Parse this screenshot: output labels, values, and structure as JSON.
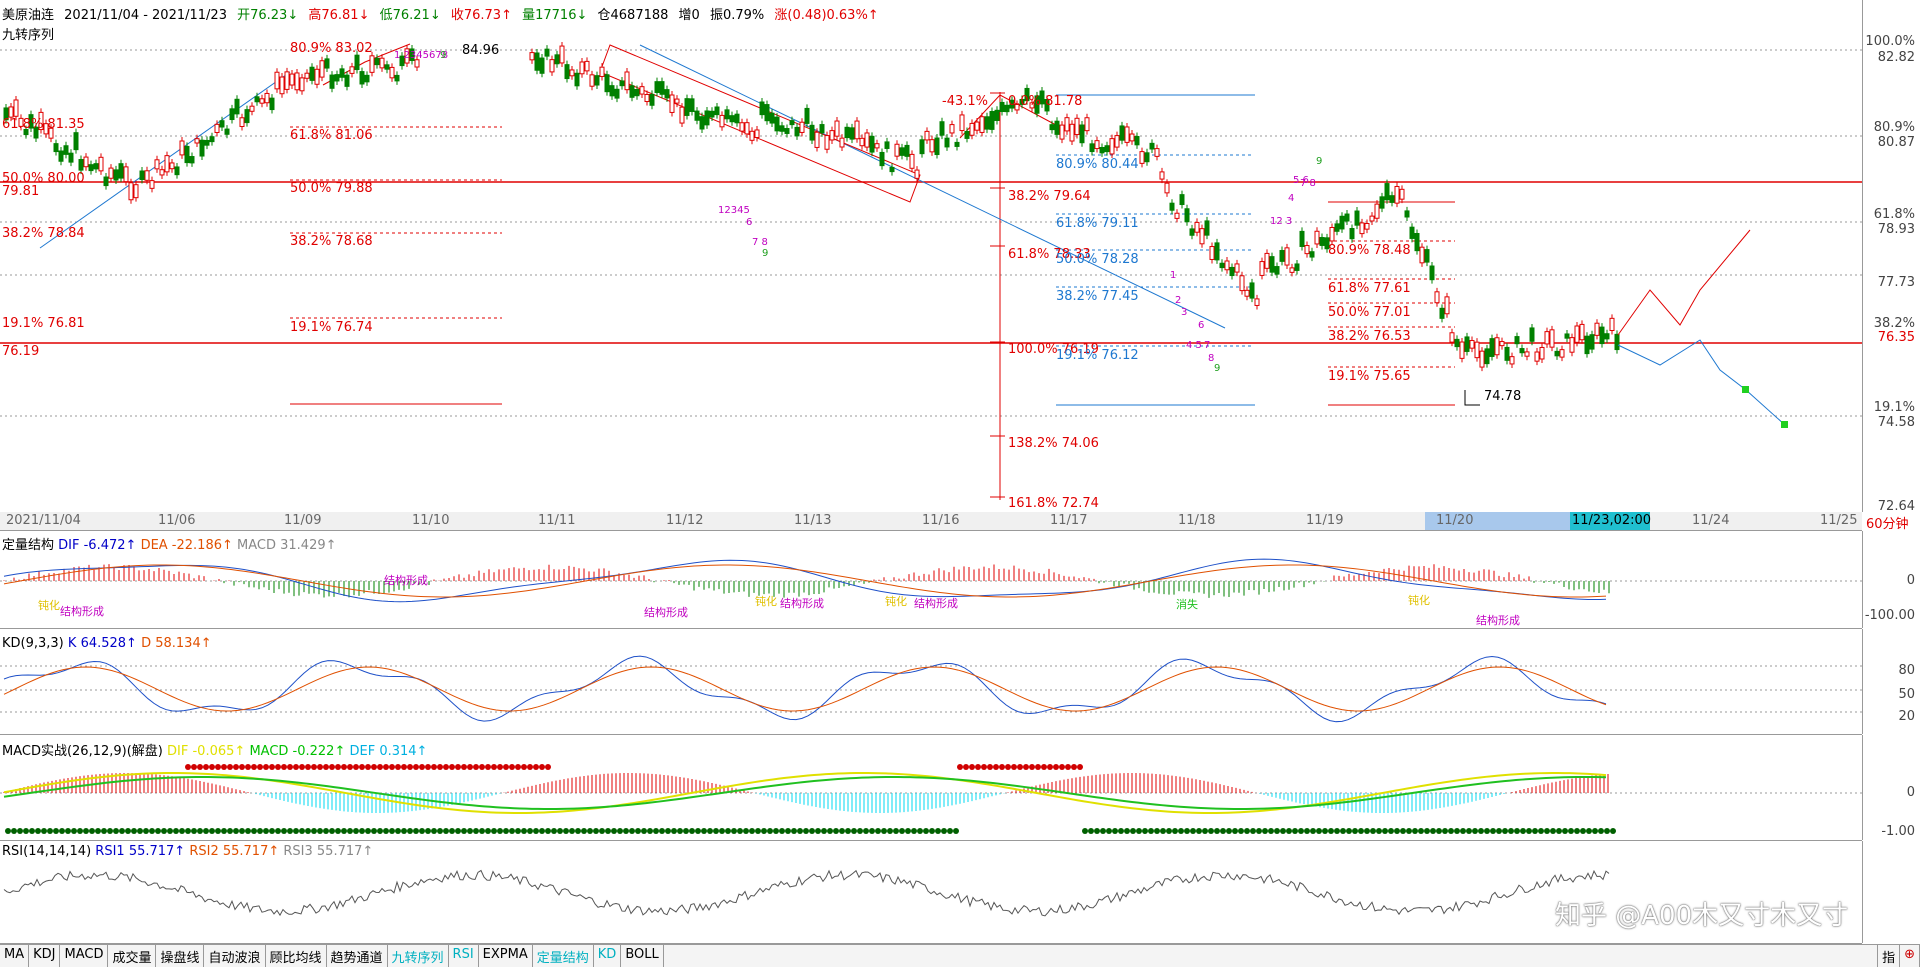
{
  "header": {
    "symbol": "美原油连",
    "range": "2021/11/04 - 2021/11/23",
    "open": "开76.23↓",
    "high": "高76.81↓",
    "low": "低76.21↓",
    "close": "收76.73↑",
    "volume": "量17716↓",
    "oi": "仓4687188",
    "oi_change": "增0",
    "amplitude": "振0.79%",
    "change": "涨(0.48)0.63%↑",
    "indicator": "九转序列"
  },
  "price_axis": [
    "100.0%",
    "82.82",
    "80.9%",
    "80.87",
    "61.8%",
    "78.93",
    "77.73",
    "38.2%",
    "76.35",
    "19.1%",
    "74.58",
    "72.64"
  ],
  "date_axis": [
    "2021/11/04",
    "11/06",
    "11/09",
    "11/10",
    "11/11",
    "11/12",
    "11/13",
    "11/16",
    "11/17",
    "11/18",
    "11/19",
    "11/20",
    "11/23,02:00",
    "11/24",
    "11/25",
    "60分钟"
  ],
  "fib_labels": [
    "80.9% 83.02",
    "61.8% 81.35",
    "61.8% 81.06",
    "50.0% 80.00",
    "79.81",
    "50.0% 79.88",
    "38.2% 78.84",
    "38.2% 78.68",
    "19.1% 76.81",
    "19.1% 76.74",
    "76.19",
    "84.96",
    "-43.1%",
    "0.0% 81.78",
    "38.2% 79.64",
    "61.8% 78.33",
    "100.0% 76.19",
    "138.2% 74.06",
    "161.8% 72.74",
    "80.9% 80.44",
    "61.8% 79.11",
    "50.0% 78.28",
    "38.2% 77.45",
    "19.1% 76.12",
    "80.9% 78.48",
    "61.8% 77.61",
    "50.0% 77.01",
    "38.2% 76.53",
    "19.1% 75.65",
    "74.78"
  ],
  "nine_seq": [
    "12345",
    "6",
    "7 8",
    "9",
    "1",
    "2",
    "3",
    "6",
    "4 5",
    "7",
    "8",
    "9",
    "12 3",
    "4",
    "5 6",
    "7 8",
    "9",
    "1 2345678",
    "9"
  ],
  "macd1": {
    "title": "定量结构",
    "dif": "DIF -6.472↑",
    "dea": "DEA -22.186↑",
    "macd": "MACD 31.429↑",
    "y0": "0",
    "y1": "-100.00",
    "labels": [
      "结构形成",
      "结构形成",
      "结构形成",
      "结构形成",
      "结构形成",
      "钝化",
      "钝化",
      "钝化",
      "消失",
      "结构形成",
      "钝化"
    ]
  },
  "kd": {
    "title": "KD(9,3,3)",
    "k": "K 64.528↑",
    "d": "D 58.134↑",
    "y80": "80",
    "y50": "50",
    "y20": "20"
  },
  "macd2": {
    "title": "MACD实战(26,12,9)(解盘)",
    "dif": "DIF -0.065↑",
    "macd": "MACD -0.222↑",
    "def": "DEF 0.314↑",
    "y0": "0",
    "y1": "-1.00"
  },
  "rsi": {
    "title": "RSI(14,14,14)",
    "r1": "RSI1 55.717↑",
    "r2": "RSI2 55.717↑",
    "r3": "RSI3 55.717↑"
  },
  "watermark": "知乎 @A00木又寸木又寸",
  "tabs": [
    "MA",
    "KDJ",
    "MACD",
    "成交量",
    "操盘线",
    "自动波浪",
    "顾比均线",
    "趋势通道",
    "九转序列",
    "RSI",
    "EXPMA",
    "定量结构",
    "KD",
    "BOLL"
  ],
  "tab_highlight": [
    false,
    false,
    false,
    false,
    false,
    false,
    false,
    false,
    true,
    true,
    false,
    true,
    true,
    false
  ],
  "corner": "指"
}
